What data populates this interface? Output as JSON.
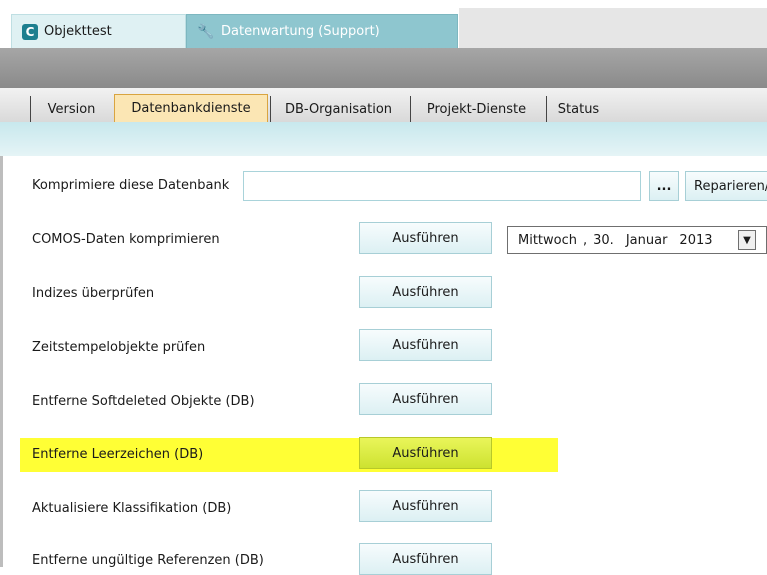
{
  "window_tabs": [
    {
      "label": "Objekttest",
      "icon": "comos-c-icon"
    },
    {
      "label": "Datenwartung (Support)",
      "icon": "tools-icon"
    }
  ],
  "sub_tabs": [
    "Version",
    "Datenbankdienste",
    "DB-Organisation",
    "Projekt-Dienste",
    "Status"
  ],
  "active_sub_tab": "Datenbankdienste",
  "compress": {
    "label": "Komprimiere diese Datenbank",
    "input_value": "",
    "browse_label": "...",
    "repair_label": "Reparieren/"
  },
  "date_picker": {
    "weekday": "Mittwoch",
    "sep": ",",
    "day": "30.",
    "month": "Januar",
    "year": "2013"
  },
  "rows": [
    {
      "label": "COMOS-Daten komprimieren",
      "button": "Ausführen"
    },
    {
      "label": "Indizes überprüfen",
      "button": "Ausführen"
    },
    {
      "label": "Zeitstempelobjekte prüfen",
      "button": "Ausführen"
    },
    {
      "label": "Entferne Softdeleted Objekte (DB)",
      "button": "Ausführen"
    },
    {
      "label": "Entferne Leerzeichen (DB)",
      "button": "Ausführen"
    },
    {
      "label": "Aktualisiere Klassifikation (DB)",
      "button": "Ausführen"
    },
    {
      "label": "Entferne ungültige Referenzen (DB)",
      "button": "Ausführen"
    }
  ],
  "colors": {
    "highlight": "#ffff35",
    "active_tab": "#fbe6b4",
    "accent": "#1d7f8f"
  }
}
